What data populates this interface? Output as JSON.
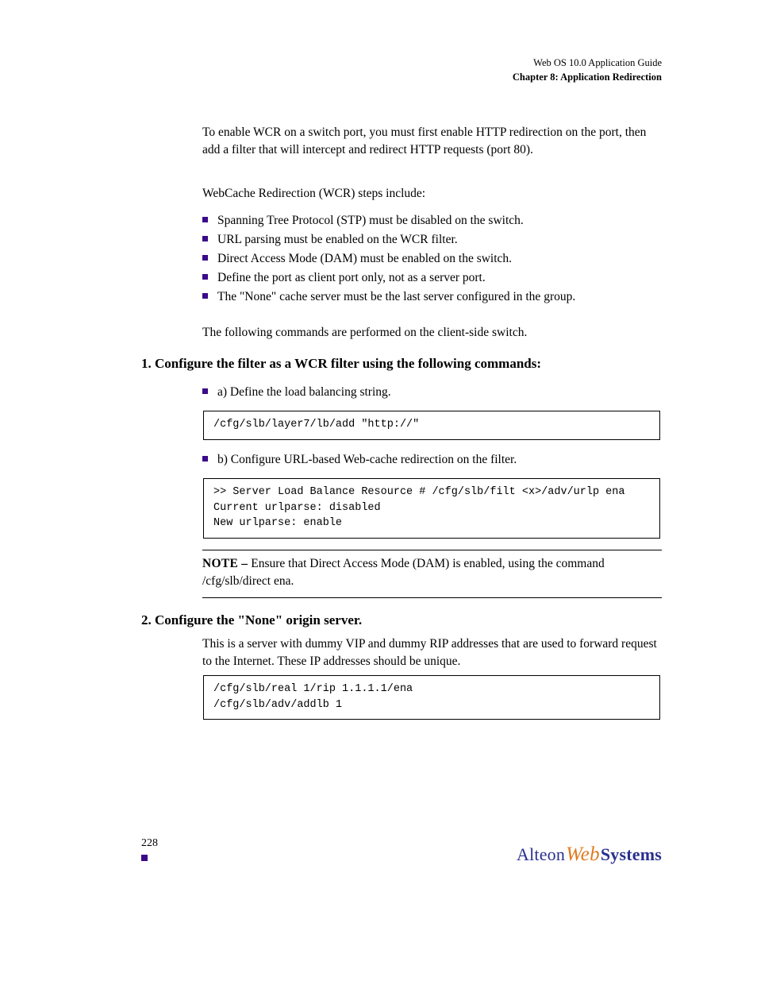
{
  "header": {
    "running": "Web OS 10.0 Application Guide",
    "chapter": "Chapter 8: Application Redirection"
  },
  "intro": "To enable WCR on a switch port, you must first enable HTTP redirection on the port, then add a filter that will intercept and redirect HTTP requests (port 80).",
  "wcr_intro": "WebCache Redirection (WCR) steps include:",
  "wcr_list": [
    "Spanning Tree Protocol (STP) must be disabled on the switch.",
    "URL parsing must be enabled on the WCR filter.",
    "Direct Access Mode (DAM) must be enabled on the switch.",
    "Define the port as client port only, not as a server port.",
    "The \"None\" cache server must be the last server configured in the group."
  ],
  "steps_label": "The following commands are performed on the client-side switch.",
  "step1": {
    "heading": "1.    Configure the filter as a WCR filter using the following commands:",
    "sub_a": {
      "label": "a) Define the load balancing string.",
      "code": "/cfg/slb/layer7/lb/add \"http://\""
    },
    "sub_b": {
      "label": "b) Configure URL-based Web-cache redirection on the filter.",
      "code": ">> Server Load Balance Resource # /cfg/slb/filt <x>/adv/urlp ena\nCurrent urlparse: disabled\nNew urlparse: enable"
    },
    "note": {
      "label": "NOTE –",
      "text": "Ensure that Direct Access Mode (DAM) is enabled, using the command  /cfg/slb/direct ena."
    }
  },
  "step2": {
    "heading": "2.    Configure the \"None\" origin server.",
    "body": "This is a server with dummy VIP and dummy RIP addresses that are used to forward request to the Internet. These IP addresses should be unique.",
    "code": "/cfg/slb/real 1/rip 1.1.1.1/ena\n/cfg/slb/adv/addlb 1"
  },
  "footer": {
    "page": "228",
    "logo_left": "Alteon",
    "logo_mid": "Web",
    "logo_right": "Systems"
  }
}
